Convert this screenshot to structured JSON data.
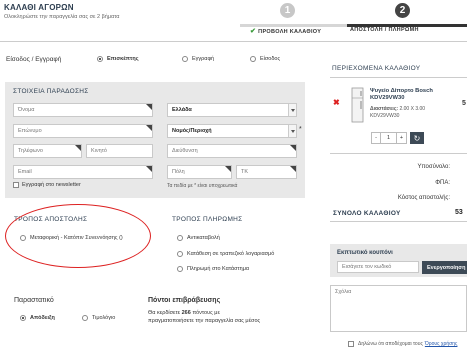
{
  "header": {
    "title": "ΚΑΛΑΘΙ ΑΓΟΡΩΝ",
    "subtitle": "Ολοκληρώστε την παραγγελία σας σε 2 βήματα",
    "step1_number": "1",
    "step1_check": "✔",
    "step1_label": "ΠΡΟΒΟΛΗ ΚΑΛΑΘΙΟΥ",
    "step2_number": "2",
    "step2_label": "ΑΠΟΣΤΟΛΗ / ΠΛΗΡΩΜΗ"
  },
  "login": {
    "label": "Είσοδος / Εγγραφή",
    "options": [
      "Επισκέπτης",
      "Εγγραφή",
      "Είσοδος"
    ],
    "selected_index": 0
  },
  "delivery": {
    "heading": "ΣΤΟΙΧΕΙΑ ΠΑΡΑΔΟΣΗΣ",
    "name_placeholder": "Όνομα",
    "country_value": "Ελλάδα",
    "surname_placeholder": "Επώνυμο",
    "region_value": "Νομός/Περιοχή",
    "phone_placeholder": "Τηλέφωνο",
    "mobile_placeholder": "Κινητό",
    "address_placeholder": "Διεύθυνση",
    "email_placeholder": "Email",
    "city_placeholder": "Πόλη",
    "zip_placeholder": "ΤΚ",
    "required_star": "*",
    "newsletter_label": "Εγγραφή στο newsletter",
    "required_note": "Τα πεδία με * είναι υποχρεωτικά"
  },
  "shipping": {
    "heading": "ΤΡΟΠΟΣ ΑΠΟΣΤΟΛΗΣ",
    "options": [
      "Μεταφορική - Κατόπιν Συνεννόησης ()"
    ]
  },
  "payment": {
    "heading": "ΤΡΟΠΟΣ ΠΛΗΡΩΜΗΣ",
    "options": [
      "Αντικαταβολή",
      "Κατάθεση σε τραπεζικό λογαριασμό",
      "Πληρωμή στο Κατάστημα"
    ]
  },
  "receipt": {
    "heading": "Παραστατικό",
    "options": [
      "Απόδειξη",
      "Τιμολόγιο"
    ],
    "selected_index": 0
  },
  "points": {
    "heading": "Πόντοι επιβράβευσης",
    "line1_pre": "Θα κερδίσετε ",
    "line1_bold": "266",
    "line1_post": " πόντους με",
    "line2": "πραγματοποιήσετε την παραγγελία σας μέσος"
  },
  "cart": {
    "heading": "ΠΕΡΙΕΧΟΜΕΝΑ ΚΑΛΑΘΙΟΥ",
    "remove_icon": "✖",
    "product_name": "Ψυγείο Δίπορτο Bosch KDV29VW30",
    "dimensions_label": "Διαστάσεις:",
    "dimensions_value": "2.00 X 3.00",
    "code": "KDV29VW30",
    "price_fragment": "5",
    "qty_minus": "-",
    "qty_value": "1",
    "qty_plus": "+",
    "refresh_icon": "↻",
    "subtotal_label": "Υποσύνολο:",
    "vat_label": "ΦΠΑ:",
    "shipping_cost_label": "Κόστος αποστολής:",
    "total_label": "ΣΥΝΟΛΟ ΚΑΛΑΘΙΟΥ",
    "total_value": "53"
  },
  "coupon": {
    "label": "Εκπτωτικό κουπόνι",
    "placeholder": "Εισάγετε τον κωδικό",
    "button": "Ενεργοποίηση"
  },
  "comments": {
    "placeholder": "Σχόλια"
  },
  "terms": {
    "text_pre": "Δηλώνω ότι αποδέχομαι τους",
    "link": "Όρους χρήσης"
  }
}
